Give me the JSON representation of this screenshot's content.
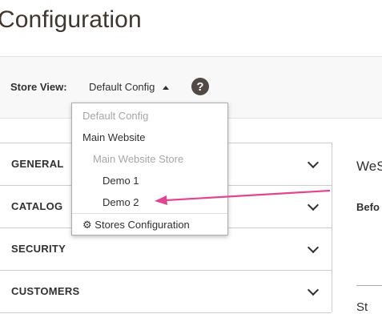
{
  "page": {
    "title": "Configuration"
  },
  "scope": {
    "label": "Store View:",
    "selected": "Default Config",
    "help": "?"
  },
  "dropdown": {
    "items": [
      {
        "label": "Default Config",
        "disabled": true
      },
      {
        "label": "Main Website",
        "disabled": false
      },
      {
        "label": "Main Website Store",
        "disabled": true
      },
      {
        "label": "Demo 1",
        "disabled": false
      },
      {
        "label": "Demo 2",
        "disabled": false
      }
    ],
    "footer_icon": "⚙",
    "footer_label": "Stores Configuration"
  },
  "sidebar": {
    "sections": [
      "GENERAL",
      "CATALOG",
      "SECURITY",
      "CUSTOMERS"
    ]
  },
  "right_panel": {
    "heading": "WeS",
    "subheading": "Befo",
    "footer": "St"
  },
  "colors": {
    "arrow": "#e0468f",
    "title": "#41362f",
    "help_bg": "#514943"
  },
  "icons": {
    "help": "question-circle-icon",
    "caret": "caret-up-icon",
    "chevron": "chevron-down-icon",
    "gear": "gear-icon"
  }
}
